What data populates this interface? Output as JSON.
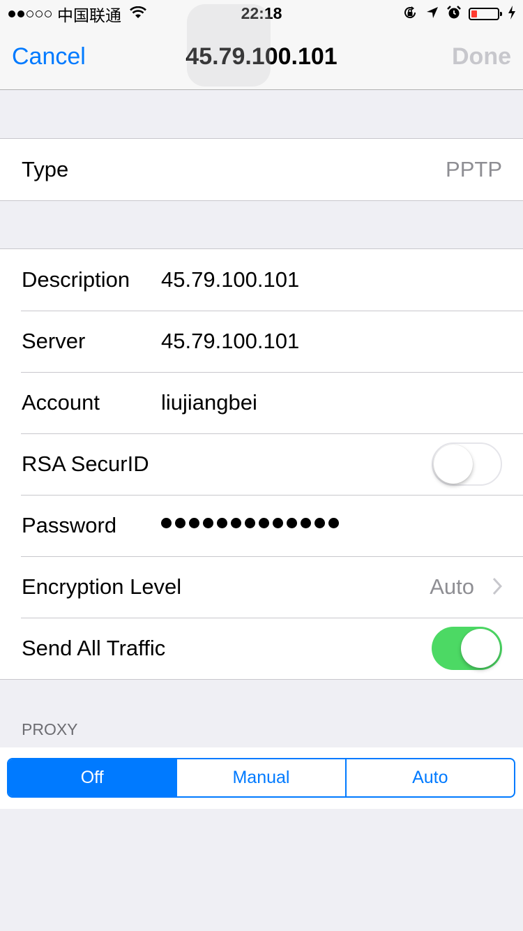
{
  "status_bar": {
    "carrier": "中国联通",
    "time": "22:18",
    "signal_bars_filled": 2,
    "signal_bars_total": 5,
    "battery_level": "low",
    "icons": [
      "wifi-icon",
      "orientation-lock-icon",
      "location-arrow-icon",
      "alarm-icon",
      "battery-icon",
      "charging-bolt-icon"
    ]
  },
  "nav": {
    "cancel_label": "Cancel",
    "title": "45.79.100.101",
    "done_label": "Done"
  },
  "type_row": {
    "label": "Type",
    "value": "PPTP"
  },
  "fields": {
    "description": {
      "label": "Description",
      "value": "45.79.100.101"
    },
    "server": {
      "label": "Server",
      "value": "45.79.100.101"
    },
    "account": {
      "label": "Account",
      "value": "liujiangbei"
    },
    "rsa": {
      "label": "RSA SecurID",
      "enabled": false
    },
    "password": {
      "label": "Password",
      "masked_length": 13
    },
    "encryption": {
      "label": "Encryption Level",
      "value": "Auto"
    },
    "send_all": {
      "label": "Send All Traffic",
      "enabled": true
    }
  },
  "proxy": {
    "header": "PROXY",
    "options": [
      "Off",
      "Manual",
      "Auto"
    ],
    "selected": "Off"
  },
  "colors": {
    "accent": "#007aff",
    "switch_on": "#4cd964",
    "background": "#efeff4",
    "disabled": "#c7c7cc"
  }
}
